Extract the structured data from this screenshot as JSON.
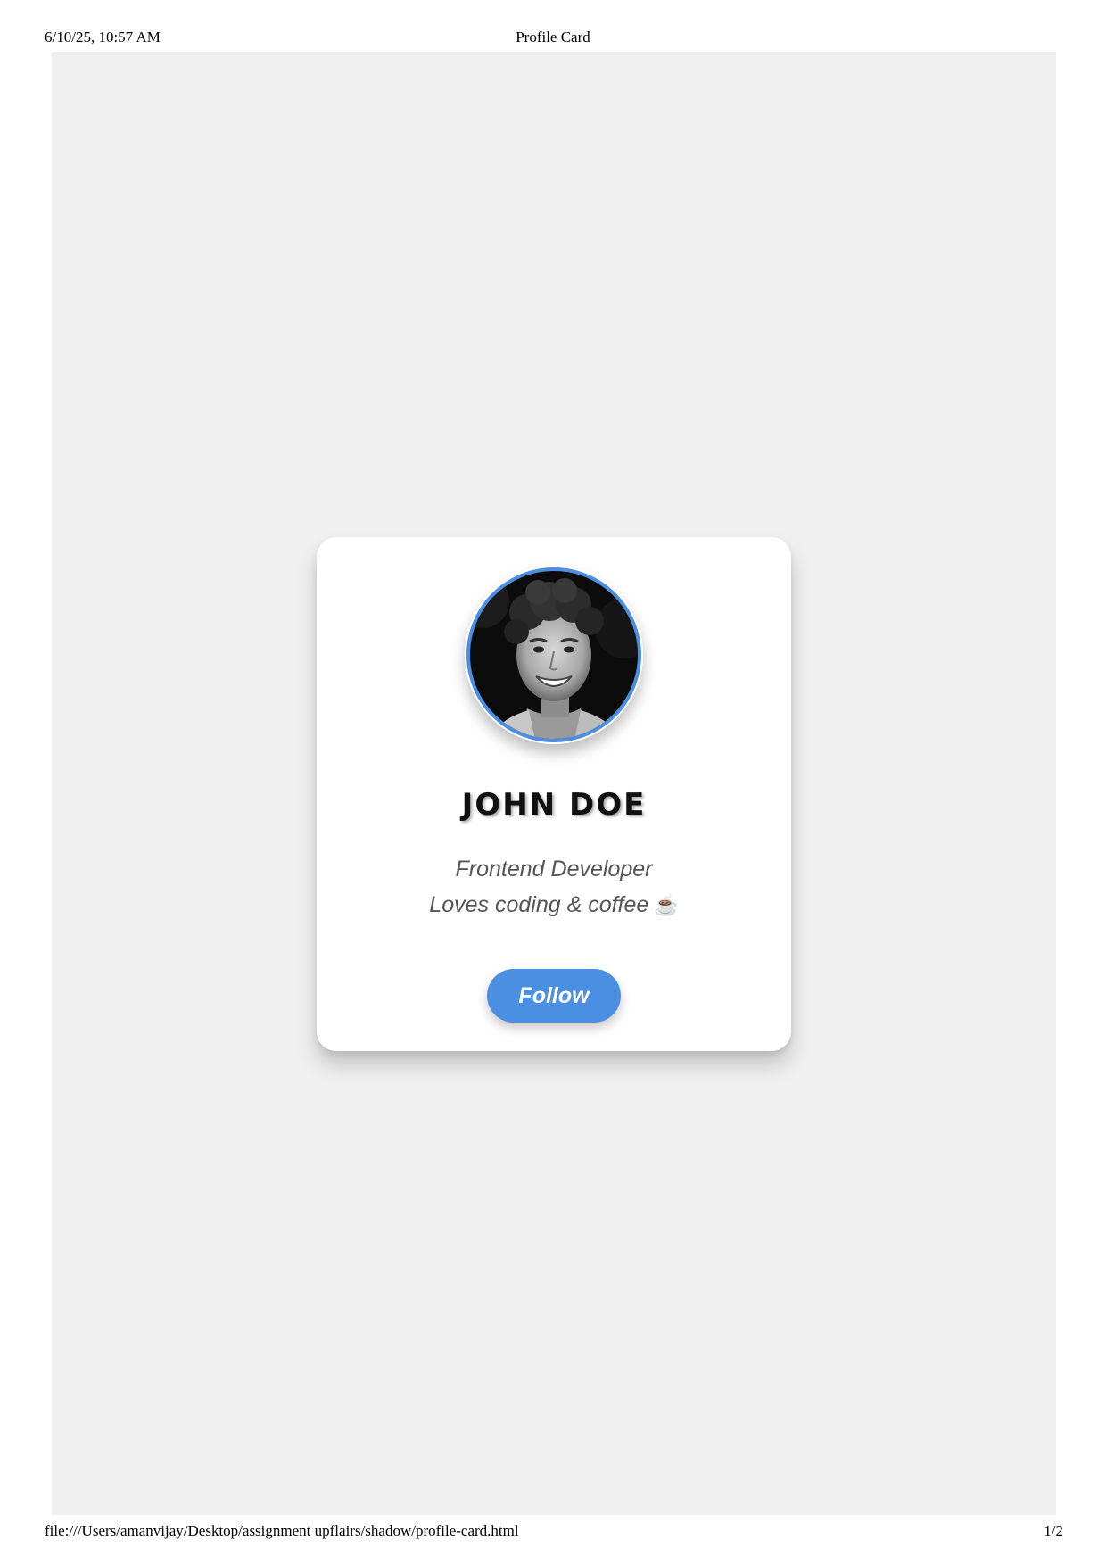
{
  "print_header": {
    "date": "6/10/25, 10:57 AM",
    "title": "Profile Card"
  },
  "card": {
    "avatar": {
      "description_icon": "profile-photo",
      "border_color": "#4a8fe2"
    },
    "name": "JOHN DOE",
    "bio": {
      "line1": "Frontend Developer",
      "line2": "Loves coding & coffee",
      "icon": "coffee-icon",
      "icon_glyph": "☕"
    },
    "follow_button": {
      "label": "Follow",
      "color": "#4a8fe2"
    }
  },
  "print_footer": {
    "url": "file:///Users/amanvijay/Desktop/assignment upflairs/shadow/profile-card.html",
    "page": "1/2"
  },
  "colors": {
    "page_background": "#f0f0f0",
    "card_background": "#ffffff",
    "accent": "#4a8fe2"
  }
}
